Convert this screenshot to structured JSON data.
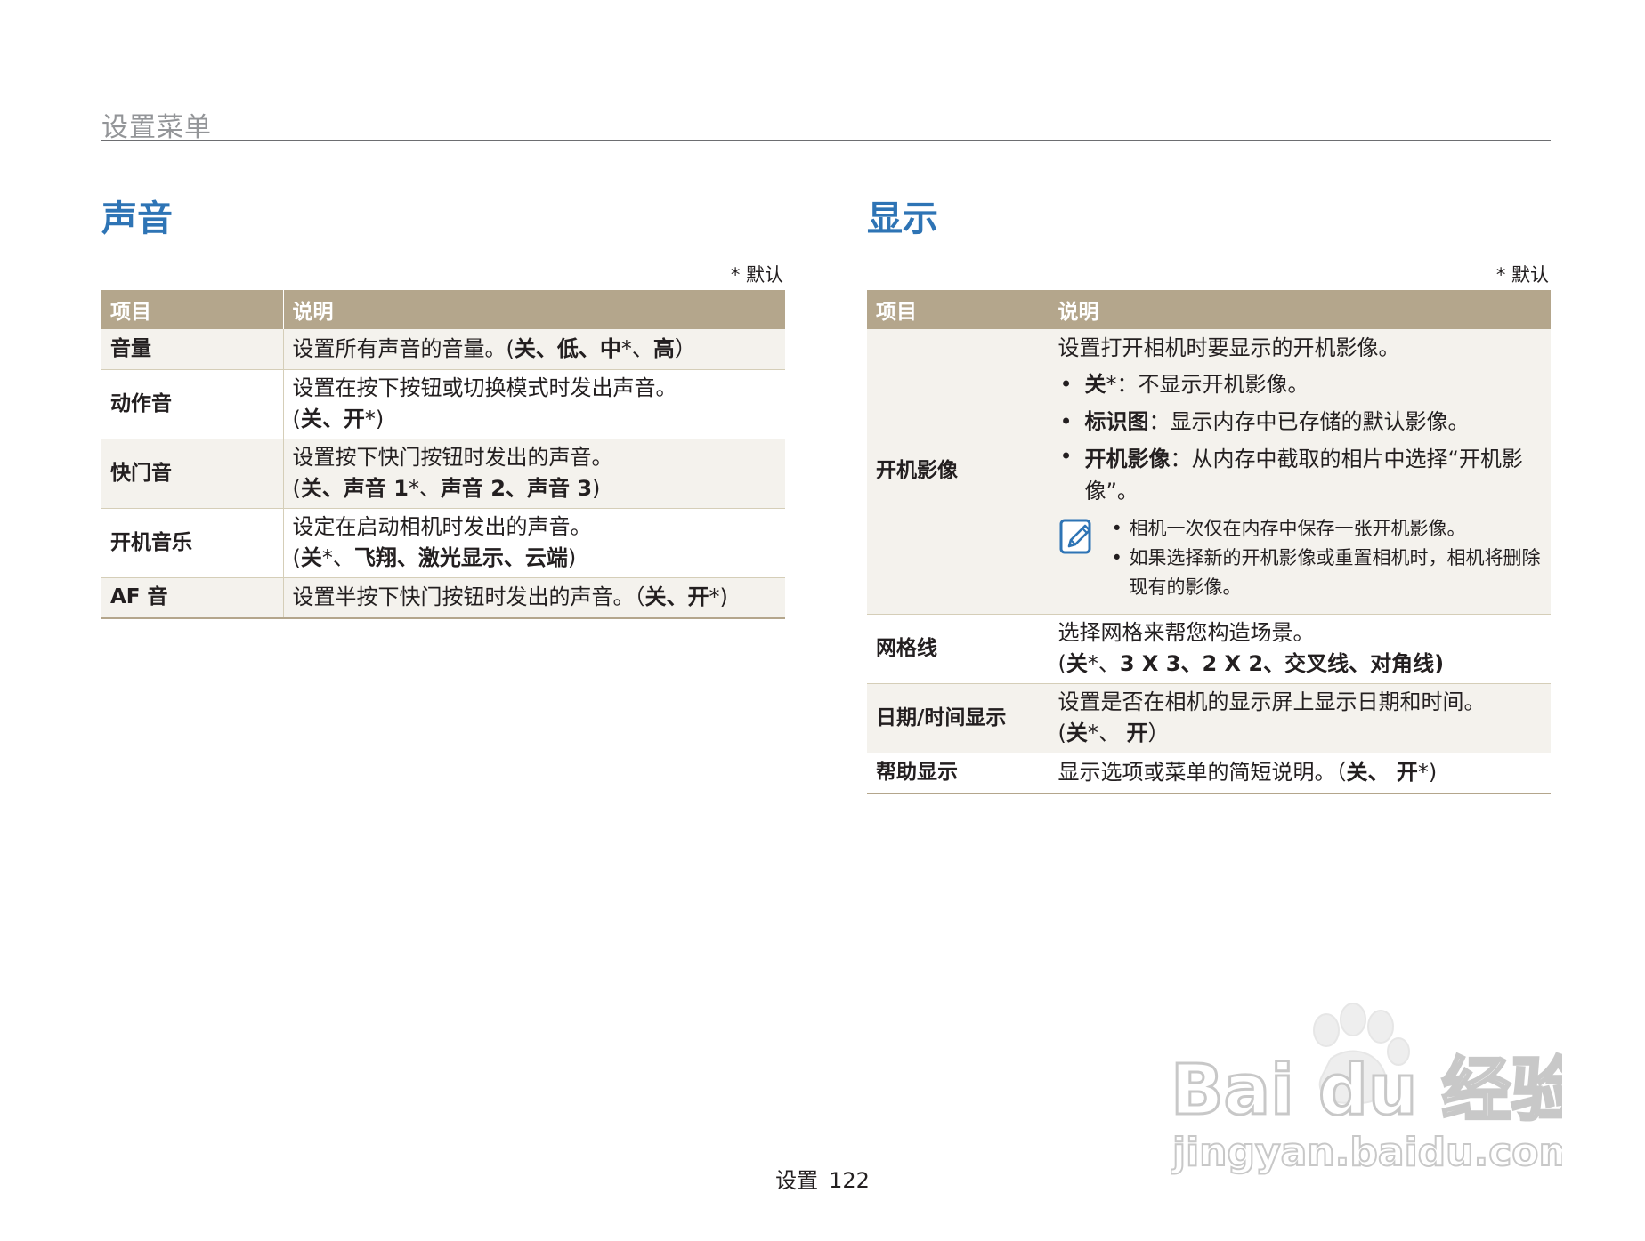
{
  "header": {
    "title": "设置菜单"
  },
  "sections": [
    {
      "title": "声音",
      "default_note": "* 默认",
      "columns": [
        "项目",
        "说明"
      ],
      "rows": [
        {
          "item": "音量",
          "desc": [
            {
              "t": "设置所有声音的音量。(",
              "b": false
            },
            {
              "t": "关、低、中",
              "b": true
            },
            {
              "t": "*、",
              "b": false
            },
            {
              "t": "高",
              "b": true
            },
            {
              "t": "）",
              "b": false
            }
          ]
        },
        {
          "item": "动作音",
          "desc_line1": "设置在按下按钮或切换模式时发出声音。",
          "desc_line2": [
            {
              "t": "(",
              "b": false
            },
            {
              "t": "关、开",
              "b": true
            },
            {
              "t": "*)",
              "b": false
            }
          ]
        },
        {
          "item": "快门音",
          "desc_line1": "设置按下快门按钮时发出的声音。",
          "desc_line2": [
            {
              "t": "(",
              "b": false
            },
            {
              "t": "关、声音 1",
              "b": true
            },
            {
              "t": "*、",
              "b": false
            },
            {
              "t": "声音 2、声音 3",
              "b": true
            },
            {
              "t": ")",
              "b": false
            }
          ]
        },
        {
          "item": "开机音乐",
          "desc_line1": "设定在启动相机时发出的声音。",
          "desc_line2": [
            {
              "t": "(",
              "b": false
            },
            {
              "t": "关",
              "b": true
            },
            {
              "t": "*、",
              "b": false
            },
            {
              "t": "飞翔、激光显示、云端",
              "b": true
            },
            {
              "t": ")",
              "b": false
            }
          ]
        },
        {
          "item": "AF 音",
          "desc": [
            {
              "t": "设置半按下快门按钮时发出的声音。（",
              "b": false
            },
            {
              "t": "关、开",
              "b": true
            },
            {
              "t": "*)",
              "b": false
            }
          ]
        }
      ]
    },
    {
      "title": "显示",
      "default_note": "* 默认",
      "columns": [
        "项目",
        "说明"
      ],
      "rows": [
        {
          "item": "开机影像",
          "intro": "设置打开相机时要显示的开机影像。",
          "bullets": [
            {
              "term": "关",
              "text": "*：不显示开机影像。"
            },
            {
              "term": "标识图",
              "text": "：显示内存中已存储的默认影像。"
            },
            {
              "term": "开机影像",
              "text": "：从内存中截取的相片中选择“开机影像”。"
            }
          ],
          "notes": [
            "相机一次仅在内存中保存一张开机影像。",
            "如果选择新的开机影像或重置相机时，相机将删除现有的影像。"
          ],
          "note_icon": "note-pencil-icon"
        },
        {
          "item": "网格线",
          "desc_line1": "选择网格来帮您构造场景。",
          "desc_line2": [
            {
              "t": "(",
              "b": false
            },
            {
              "t": "关",
              "b": true
            },
            {
              "t": "*、",
              "b": false
            },
            {
              "t": "3 X 3、2 X 2、交叉线、对角线)",
              "b": true
            }
          ]
        },
        {
          "item": "日期/时间显示",
          "desc_line1": "设置是否在相机的显示屏上显示日期和时间。",
          "desc_line2": [
            {
              "t": "(",
              "b": false
            },
            {
              "t": "关",
              "b": true
            },
            {
              "t": "*、 ",
              "b": false
            },
            {
              "t": "开",
              "b": true
            },
            {
              "t": "）",
              "b": false
            }
          ]
        },
        {
          "item": "帮助显示",
          "desc": [
            {
              "t": "显示选项或菜单的简短说明。（",
              "b": false
            },
            {
              "t": "关、 开",
              "b": true
            },
            {
              "t": "*)",
              "b": false
            }
          ]
        }
      ]
    }
  ],
  "footer": {
    "section": "设置",
    "page": "122"
  },
  "watermark": {
    "brand": "Bai du 经验",
    "url": "jingyan.baidu.com"
  },
  "colors": {
    "accent_title": "#2e74b5",
    "table_header": "#b4a68c",
    "row_alt": "#f4f2ed",
    "text": "#231f20"
  }
}
